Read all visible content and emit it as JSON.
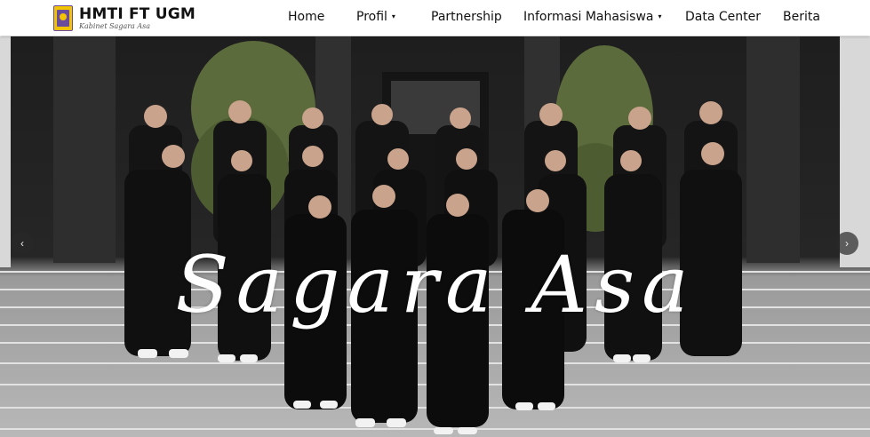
{
  "brand": {
    "title": "HMTI FT UGM",
    "subtitle": "Kabinet Sagara Asa"
  },
  "nav": {
    "items": [
      {
        "label": "Home"
      },
      {
        "label": "Profil",
        "dropdown": true
      },
      {
        "label": "Partnership"
      },
      {
        "label": "Informasi Mahasiswa",
        "dropdown": true
      },
      {
        "label": "Data Center"
      },
      {
        "label": "Berita"
      }
    ],
    "caret": "▾"
  },
  "hero": {
    "script_title": "Sagara Asa",
    "prev_icon": "‹",
    "next_icon": "›"
  },
  "colors": {
    "logo_yellow": "#f2c400",
    "logo_purple": "#6a4c9c",
    "navbar_bg": "#ffffff",
    "text": "#111111"
  }
}
